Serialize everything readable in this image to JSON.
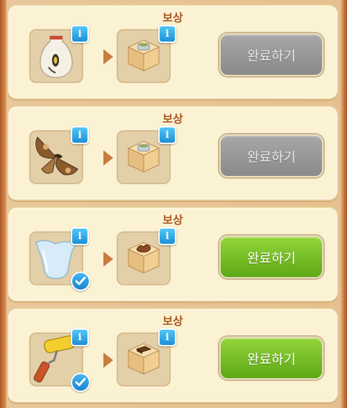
{
  "quests": [
    {
      "title": "보상",
      "item_icon": "vase-icon",
      "reward_icon": "reward-box-food-icon",
      "completed": false,
      "button_label": "완료하기",
      "button_state": "disabled"
    },
    {
      "title": "보상",
      "item_icon": "moth-icon",
      "reward_icon": "reward-box-food-icon",
      "completed": false,
      "button_label": "완료하기",
      "button_state": "disabled"
    },
    {
      "title": "보상",
      "item_icon": "glass-vase-icon",
      "reward_icon": "reward-box-bread-icon",
      "completed": true,
      "button_label": "완료하기",
      "button_state": "enabled"
    },
    {
      "title": "보상",
      "item_icon": "paint-roller-icon",
      "reward_icon": "reward-box-chocolate-icon",
      "completed": true,
      "button_label": "완료하기",
      "button_state": "enabled"
    }
  ],
  "info_label": "i",
  "colors": {
    "panel_bg": "#fbf1d3",
    "title": "#a8561f",
    "button_enabled": "#6fb823",
    "button_disabled": "#9a9a9a",
    "info_badge": "#2aa3e6"
  }
}
